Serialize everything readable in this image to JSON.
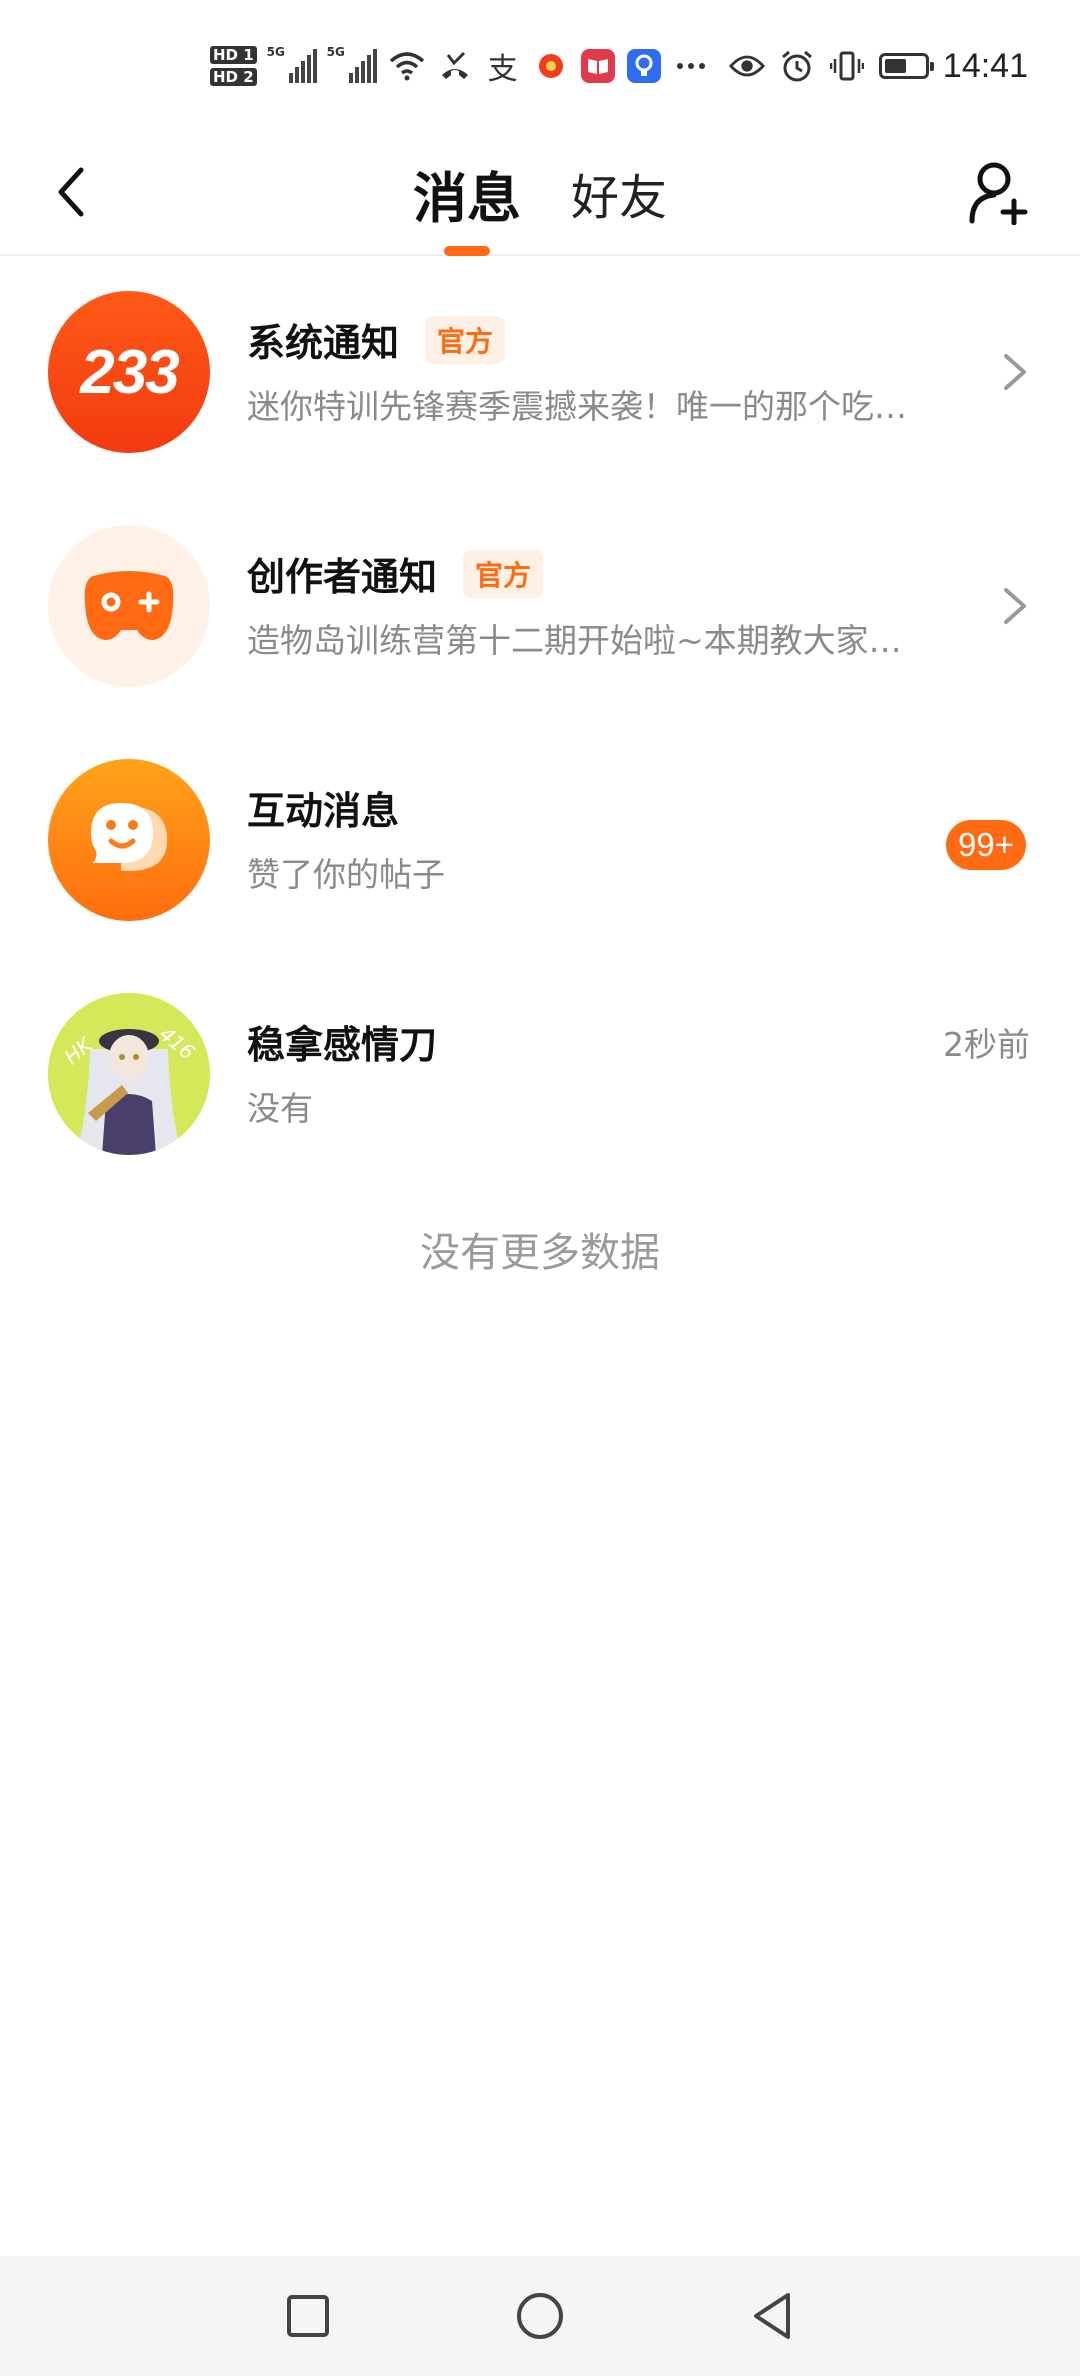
{
  "status_bar": {
    "hd1": "HD 1",
    "hd2": "HD 2",
    "sig1_label": "5G",
    "sig2_label": "5G",
    "time": "14:41",
    "battery_percent": 55
  },
  "header": {
    "tabs": [
      {
        "label": "消息",
        "active": true
      },
      {
        "label": "好友",
        "active": false
      }
    ]
  },
  "messages": [
    {
      "title": "系统通知",
      "tag": "官方",
      "subtitle": "迷你特训先锋赛季震撼来袭！唯一的那个吃…",
      "avatar_text": "233",
      "trail": "chevron"
    },
    {
      "title": "创作者通知",
      "tag": "官方",
      "subtitle": "造物岛训练营第十二期开始啦~本期教大家…",
      "trail": "chevron"
    },
    {
      "title": "互动消息",
      "subtitle": "赞了你的帖子",
      "badge": "99+"
    },
    {
      "title": "稳拿感情刀",
      "subtitle": "没有",
      "time": "2秒前",
      "avatar_text_left": "HK",
      "avatar_text_right": "416"
    }
  ],
  "footer_text": "没有更多数据",
  "colors": {
    "accent": "#ff6a13",
    "muted": "#8a8a8a"
  }
}
